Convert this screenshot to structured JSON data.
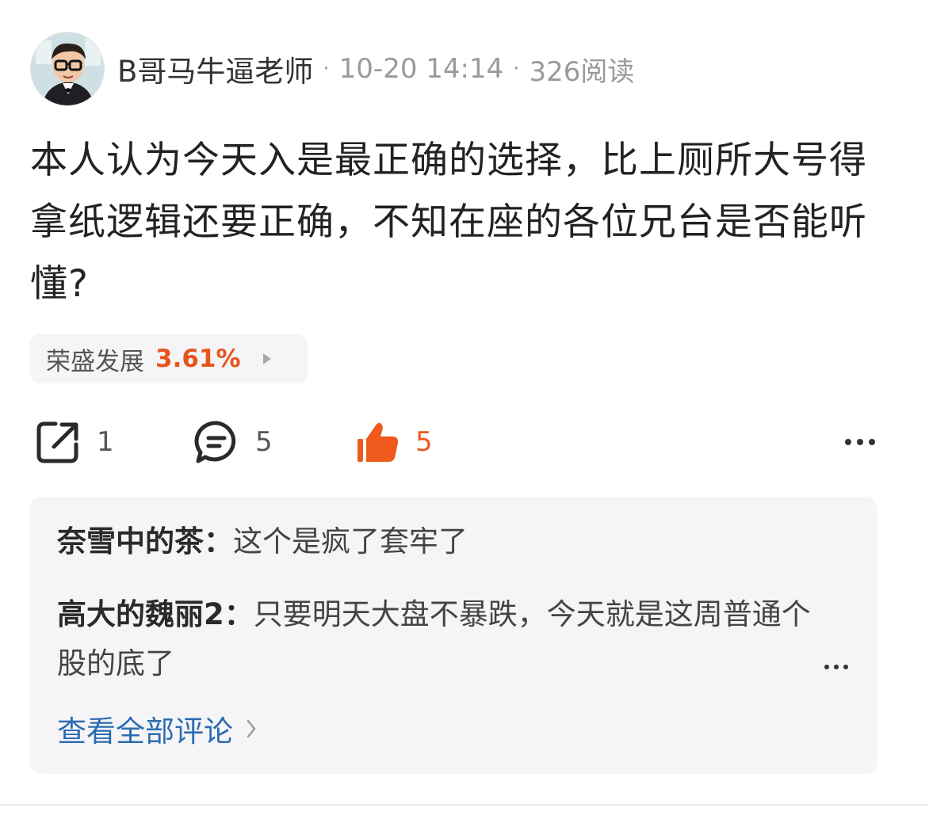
{
  "post": {
    "author": "B哥马牛逼老师",
    "separator": "·",
    "time": "10-20 14:14",
    "reads": "326阅读",
    "content": "本人认为今天入是最正确的选择，比上厕所大号得拿纸逻辑还要正确，不知在座的各位兄台是否能听懂?",
    "stock": {
      "name": "荣盛发展",
      "change": "3.61%"
    },
    "actions": {
      "share_count": "1",
      "comment_count": "5",
      "like_count": "5"
    }
  },
  "comments": [
    {
      "author": "奈雪中的茶：",
      "text": "这个是疯了套牢了"
    },
    {
      "author": "高大的魏丽2：",
      "text": "只要明天大盘不暴跌，今天就是这周普通个股的底了"
    }
  ],
  "view_all_label": "查看全部评论",
  "colors": {
    "accent_orange": "#ee5a1c",
    "link_blue": "#2b6cb0",
    "muted": "#9a9a9a",
    "panel_bg": "#f5f5f7"
  },
  "icons": [
    "share-icon",
    "comment-icon",
    "thumbs-up-icon",
    "more-icon",
    "chevron-right-icon"
  ]
}
